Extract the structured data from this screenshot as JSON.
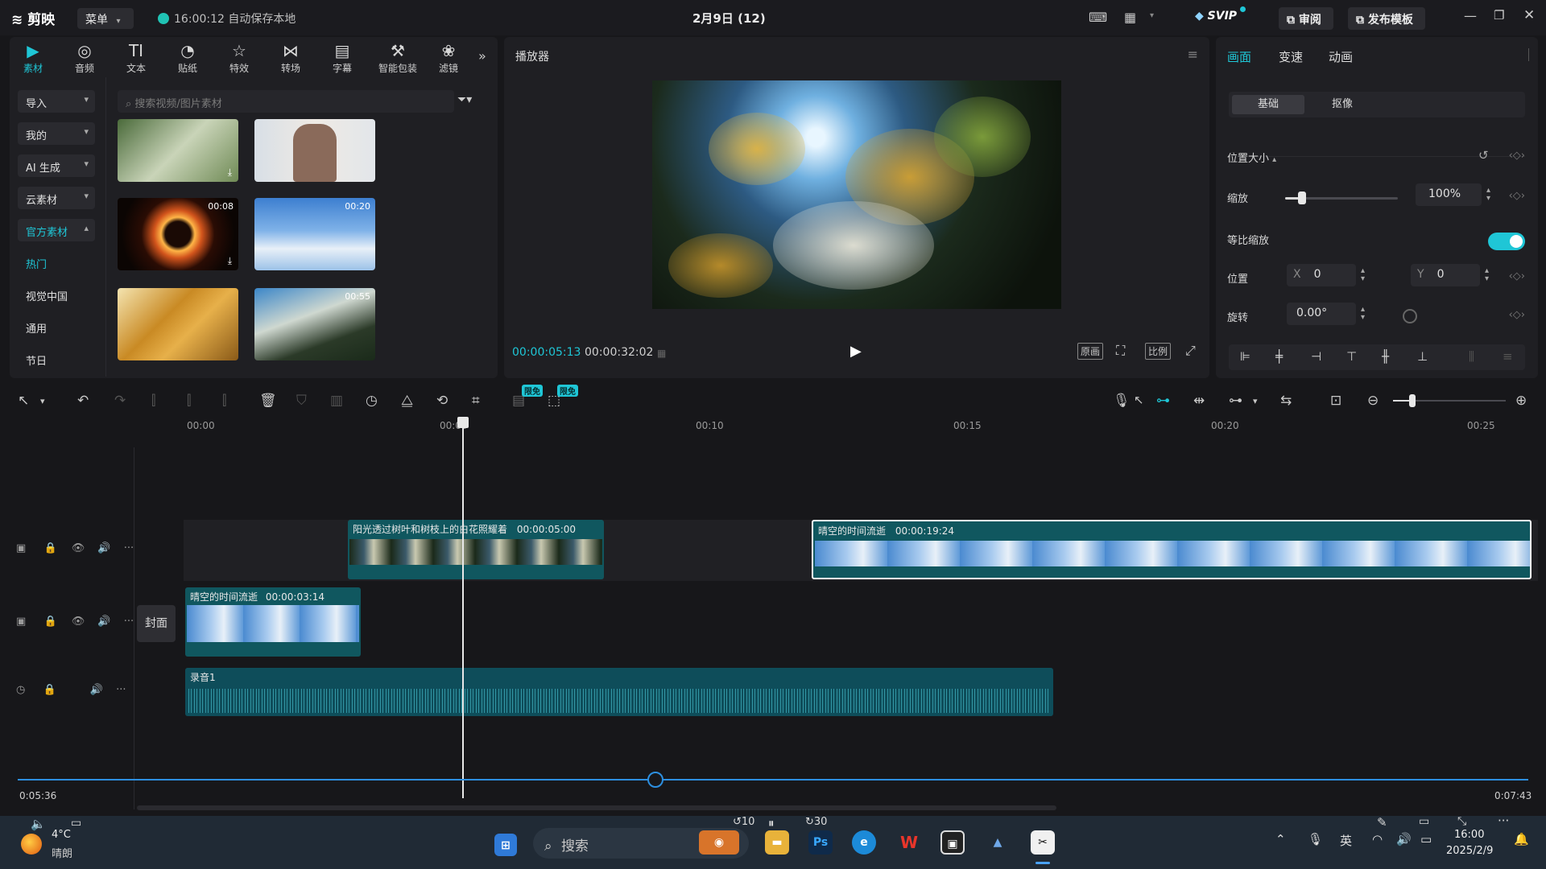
{
  "app": {
    "logo_text": "剪映",
    "menu_label": "菜单",
    "save_status": "16:00:12 自动保存本地",
    "project_title": "2月9日 (12)",
    "svip_label": "SVIP",
    "review_label": "审阅",
    "publish_label": "发布模板"
  },
  "media": {
    "tabs": [
      {
        "label": "素材",
        "icon": "media-icon"
      },
      {
        "label": "音频",
        "icon": "audio-icon"
      },
      {
        "label": "文本",
        "icon": "text-icon"
      },
      {
        "label": "贴纸",
        "icon": "sticker-icon"
      },
      {
        "label": "特效",
        "icon": "effects-icon"
      },
      {
        "label": "转场",
        "icon": "transition-icon"
      },
      {
        "label": "字幕",
        "icon": "subtitle-icon"
      },
      {
        "label": "智能包装",
        "icon": "smart-pack-icon"
      },
      {
        "label": "滤镜",
        "icon": "filter-icon"
      }
    ],
    "side": [
      "导入",
      "我的",
      "AI 生成",
      "云素材",
      "官方素材",
      "热门",
      "视觉中国",
      "通用",
      "节日"
    ],
    "search_placeholder": "搜索视频/图片素材",
    "thumbs": [
      {
        "duration": ""
      },
      {
        "duration": ""
      },
      {
        "duration": "00:08"
      },
      {
        "duration": "00:20"
      },
      {
        "duration": ""
      },
      {
        "duration": "00:55"
      }
    ]
  },
  "player": {
    "title": "播放器",
    "current_time": "00:00:05:13",
    "total_time": "00:00:32:02",
    "original_label": "原画",
    "ratio_label": "比例"
  },
  "props": {
    "tabs": [
      "画面",
      "变速",
      "动画"
    ],
    "sub_tabs": [
      "基础",
      "抠像"
    ],
    "section_title": "位置大小",
    "scale_label": "缩放",
    "scale_value": "100%",
    "scale_level": 0.15,
    "uniform_label": "等比缩放",
    "uniform_on": true,
    "position_label": "位置",
    "x_label": "X",
    "x_value": "0",
    "y_label": "Y",
    "y_value": "0",
    "rotate_label": "旋转",
    "rotate_value": "0.00°"
  },
  "timeline": {
    "ruler": [
      "00:00",
      "00:05",
      "00:10",
      "00:15",
      "00:20",
      "00:25"
    ],
    "badge_label": "限免",
    "cover_label": "封面",
    "clips": {
      "main1_name": "阳光透过树叶和树枝上的白花照耀着",
      "main1_dur": "00:00:05:00",
      "main2_name": "晴空的时间流逝",
      "main2_dur": "00:00:19:24",
      "pip_name": "晴空的时间流逝",
      "pip_dur": "00:00:03:14",
      "audio_name": "录音1"
    },
    "scroll_start": "0:05:36",
    "scroll_end": "0:07:43"
  },
  "taskbar": {
    "weather_temp": "4°C",
    "weather_text": "晴朗",
    "search_label": "搜索",
    "ime": "英",
    "time": "16:00",
    "date": "2025/2/9"
  },
  "colors": {
    "accent": "#1fc6d6",
    "clip_bg": "#10575f",
    "audio_bg": "#0e4d5a"
  }
}
